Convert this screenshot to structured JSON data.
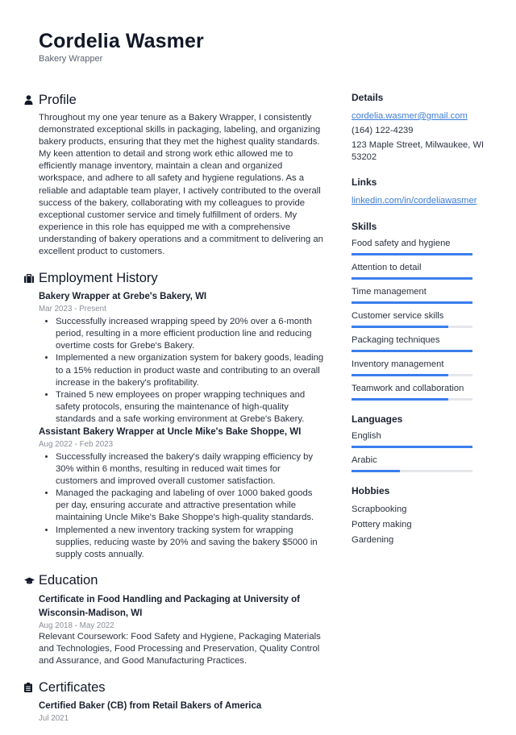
{
  "header": {
    "name": "Cordelia Wasmer",
    "title": "Bakery Wrapper"
  },
  "profile": {
    "heading": "Profile",
    "text": "Throughout my one year tenure as a Bakery Wrapper, I consistently demonstrated exceptional skills in packaging, labeling, and organizing bakery products, ensuring that they met the highest quality standards. My keen attention to detail and strong work ethic allowed me to efficiently manage inventory, maintain a clean and organized workspace, and adhere to all safety and hygiene regulations. As a reliable and adaptable team player, I actively contributed to the overall success of the bakery, collaborating with my colleagues to provide exceptional customer service and timely fulfillment of orders. My experience in this role has equipped me with a comprehensive understanding of bakery operations and a commitment to delivering an excellent product to customers."
  },
  "employment": {
    "heading": "Employment History",
    "jobs": [
      {
        "title": "Bakery Wrapper at Grebe's Bakery, WI",
        "dates": "Mar 2023 - Present",
        "bullets": [
          "Successfully increased wrapping speed by 20% over a 6-month period, resulting in a more efficient production line and reducing overtime costs for Grebe's Bakery.",
          "Implemented a new organization system for bakery goods, leading to a 15% reduction in product waste and contributing to an overall increase in the bakery's profitability.",
          "Trained 5 new employees on proper wrapping techniques and safety protocols, ensuring the maintenance of high-quality standards and a safe working environment at Grebe's Bakery."
        ]
      },
      {
        "title": "Assistant Bakery Wrapper at Uncle Mike's Bake Shoppe, WI",
        "dates": "Aug 2022 - Feb 2023",
        "bullets": [
          "Successfully increased the bakery's daily wrapping efficiency by 30% within 6 months, resulting in reduced wait times for customers and improved overall customer satisfaction.",
          "Managed the packaging and labeling of over 1000 baked goods per day, ensuring accurate and attractive presentation while maintaining Uncle Mike's Bake Shoppe's high-quality standards.",
          "Implemented a new inventory tracking system for wrapping supplies, reducing waste by 20% and saving the bakery $5000 in supply costs annually."
        ]
      }
    ]
  },
  "education": {
    "heading": "Education",
    "title": "Certificate in Food Handling and Packaging at University of Wisconsin-Madison, WI",
    "dates": "Aug 2018 - May 2022",
    "text": "Relevant Coursework: Food Safety and Hygiene, Packaging Materials and Technologies, Food Processing and Preservation, Quality Control and Assurance, and Good Manufacturing Practices."
  },
  "certificates": {
    "heading": "Certificates",
    "title": "Certified Baker (CB) from Retail Bakers of America",
    "dates": "Jul 2021"
  },
  "details": {
    "heading": "Details",
    "email": "cordelia.wasmer@gmail.com",
    "phone": "(164) 122-4239",
    "address": "123 Maple Street, Milwaukee, WI 53202"
  },
  "links": {
    "heading": "Links",
    "linkedin": "linkedin.com/in/cordeliawasmer"
  },
  "skills": {
    "heading": "Skills",
    "items": [
      {
        "label": "Food safety and hygiene",
        "level": 1.0
      },
      {
        "label": "Attention to detail",
        "level": 1.0
      },
      {
        "label": "Time management",
        "level": 1.0
      },
      {
        "label": "Customer service skills",
        "level": 0.8
      },
      {
        "label": "Packaging techniques",
        "level": 1.0
      },
      {
        "label": "Inventory management",
        "level": 0.8
      },
      {
        "label": "Teamwork and collaboration",
        "level": 0.8
      }
    ]
  },
  "languages": {
    "heading": "Languages",
    "items": [
      {
        "label": "English",
        "level": 1.0
      },
      {
        "label": "Arabic",
        "level": 0.4
      }
    ]
  },
  "hobbies": {
    "heading": "Hobbies",
    "items": [
      "Scrapbooking",
      "Pottery making",
      "Gardening"
    ]
  },
  "colors": {
    "accent": "#3b7ded",
    "link": "#3b7bd6",
    "track": "#e4e6ea"
  }
}
